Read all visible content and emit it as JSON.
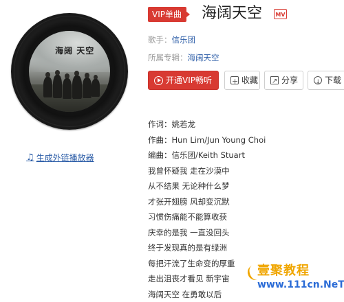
{
  "header": {
    "badge": "VIP单曲",
    "title": "海阔天空",
    "mv_label": "MV"
  },
  "meta": {
    "singer_label": "歌手：",
    "singer": "信乐团",
    "album_label": "所属专辑：",
    "album": "海阔天空"
  },
  "buttons": {
    "vip_play": "开通VIP畅听",
    "favorite": "收藏",
    "share": "分享",
    "download": "下载"
  },
  "cover": {
    "text_line1": "海阔",
    "text_line2": "天空"
  },
  "embed_link": "生成外链播放器",
  "lyrics": [
    "作词：姚若龙",
    "作曲：Hun Lim/Jun Young Choi",
    "编曲：信乐团/Keith Stuart",
    "我曾怀疑我 走在沙漠中",
    "从不结果 无论种什么梦",
    "才张开翅膀 风却变沉默",
    "习惯伤痛能不能算收获",
    "庆幸的是我 一直没回头",
    "终于发现真的是有绿洲",
    "每把汗流了生命变的厚重",
    "走出沮丧才看见 新宇宙",
    "海阔天空 在勇敢以后"
  ],
  "watermark": {
    "brand": "壹聚教程",
    "url": "www.111cn.NeT"
  },
  "colors": {
    "accent_red": "#d83a32",
    "link_blue": "#2d5ea8"
  }
}
